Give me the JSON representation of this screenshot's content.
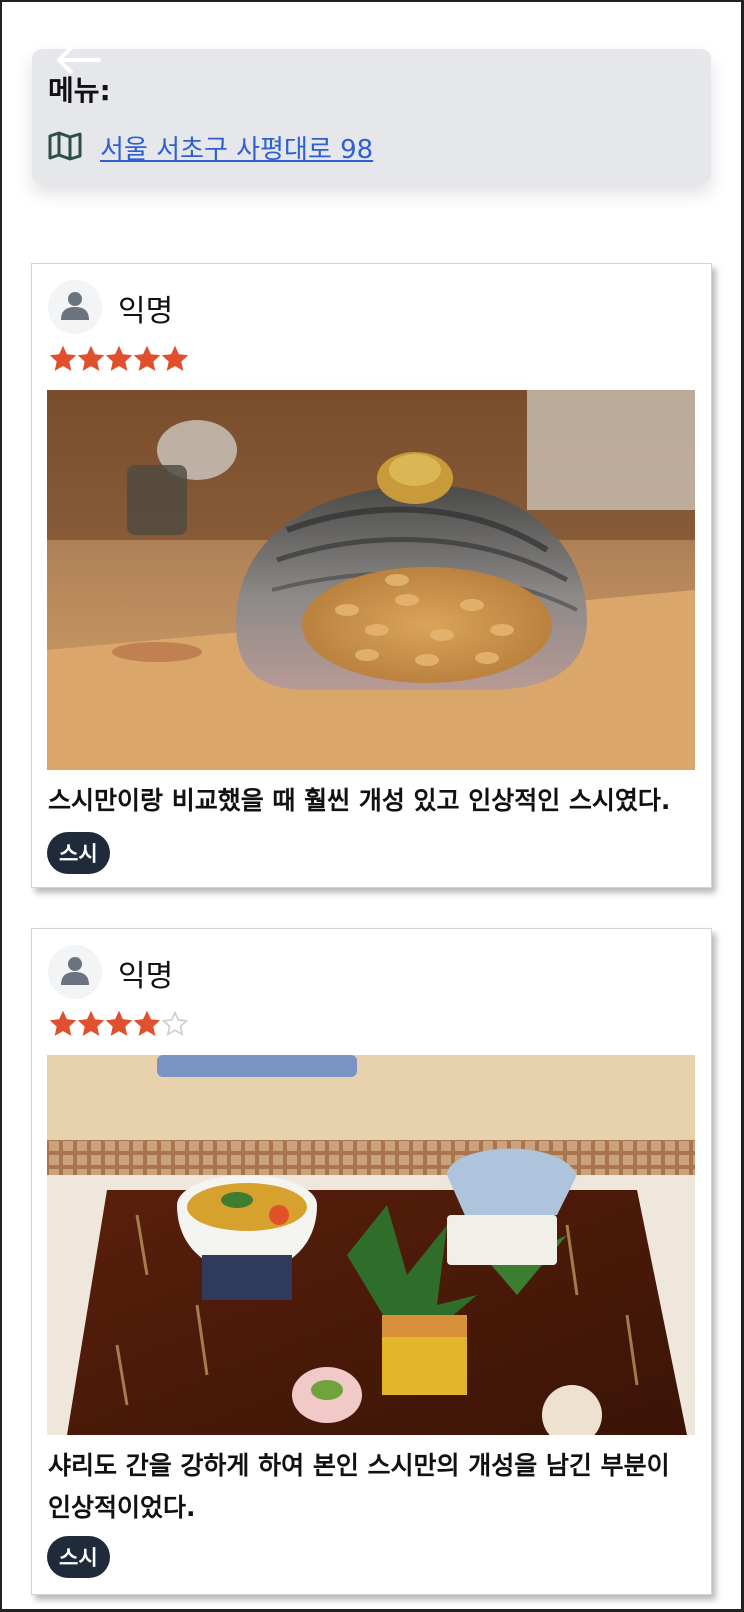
{
  "header": {
    "back_icon": "arrow-left-icon",
    "menu_label": "메뉴:",
    "map_icon": "map-icon",
    "address": "서울 서초구 사평대로 98"
  },
  "colors": {
    "star_filled": "#e0502f",
    "star_empty": "#c9ccd3",
    "link": "#2f5fd0",
    "tag_bg": "#1f2a3a",
    "card_bg": "#e5e7eb",
    "map_icon": "#2d4f44"
  },
  "reviews": [
    {
      "author": "익명",
      "avatar_icon": "person-icon",
      "rating": 5,
      "max_rating": 5,
      "photo": "sushi-nigiri-photo",
      "text": "스시만이랑 비교했을 때 훨씬 개성 있고 인상적인 스시였다.",
      "tag": "스시"
    },
    {
      "author": "익명",
      "avatar_icon": "person-icon",
      "rating": 4,
      "max_rating": 5,
      "photo": "appetizer-platter-photo",
      "text": "샤리도 간을 강하게 하여 본인 스시만의 개성을 남긴 부분이 인상적이었다.",
      "tag": "스시"
    }
  ]
}
